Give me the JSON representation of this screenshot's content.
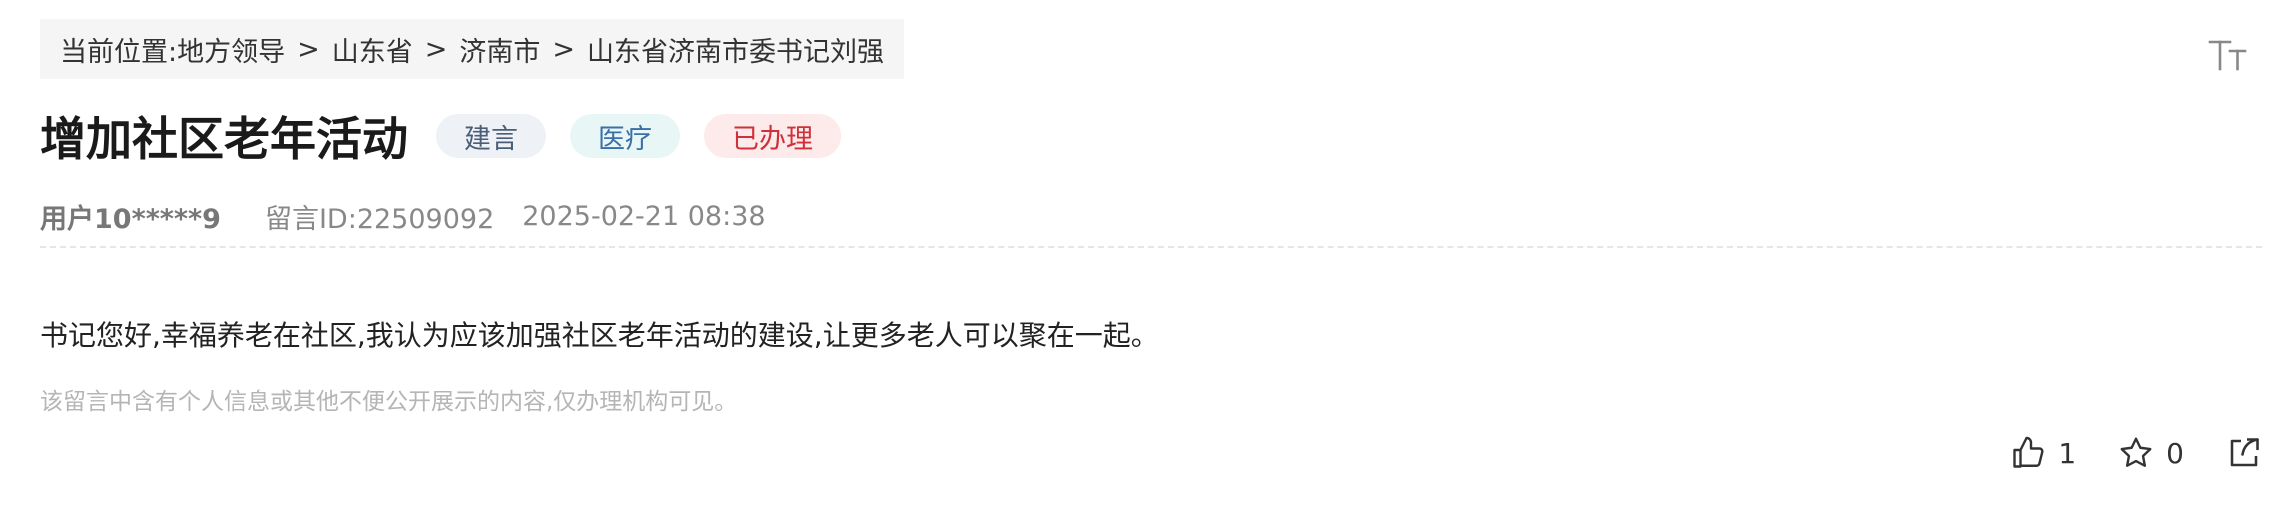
{
  "breadcrumb": {
    "prefix": "当前位置:",
    "items": [
      "地方领导",
      "山东省",
      "济南市",
      "山东省济南市委书记刘强"
    ],
    "separator": ">"
  },
  "toolbar": {
    "font_size_icon": "font-size-icon"
  },
  "message": {
    "title": "增加社区老年活动",
    "tags": {
      "type": "建言",
      "field": "医疗",
      "status": "已办理"
    },
    "user": "用户10*****9",
    "id_label": "留言ID:22509092",
    "datetime": "2025-02-21 08:38",
    "content": "书记您好,幸福养老在社区,我认为应该加强社区老年活动的建设,让更多老人可以聚在一起。",
    "notice": "该留言中含有个人信息或其他不便公开展示的内容,仅办理机构可见。"
  },
  "actions": {
    "like_count": "1",
    "favorite_count": "0",
    "icons": [
      "thumbs-up-icon",
      "star-icon",
      "share-icon"
    ]
  },
  "colors": {
    "tag_status": "#d0303a",
    "tag_field": "#3a6fa8",
    "tag_type": "#4a5e78"
  }
}
